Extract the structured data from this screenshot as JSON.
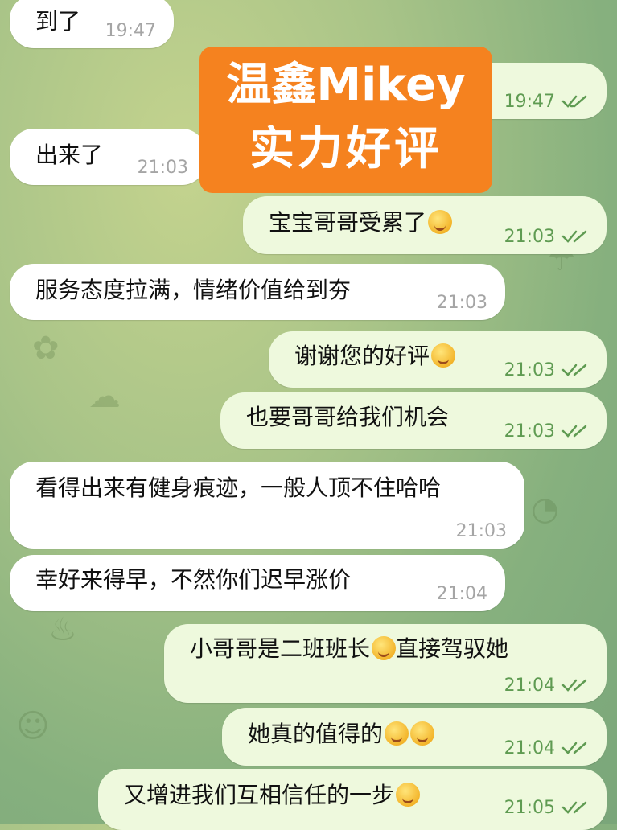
{
  "overlay": {
    "line1": "温鑫Mikey",
    "line2": "实力好评"
  },
  "messages": [
    {
      "id": "m1",
      "dir": "in",
      "text": "到了",
      "time": "19:47"
    },
    {
      "id": "m2",
      "dir": "out",
      "text": "",
      "time": "19:47"
    },
    {
      "id": "m3",
      "dir": "in",
      "text": "出来了",
      "time": "21:03"
    },
    {
      "id": "m4",
      "dir": "out",
      "text": "宝宝哥哥受累了",
      "emoji": [
        "face-blowing-kiss"
      ],
      "time": "21:03"
    },
    {
      "id": "m5",
      "dir": "in",
      "text": "服务态度拉满，情绪价值给到夯",
      "time": "21:03"
    },
    {
      "id": "m6",
      "dir": "out",
      "text": "谢谢您的好评",
      "emoji": [
        "face-savoring-food"
      ],
      "time": "21:03"
    },
    {
      "id": "m7",
      "dir": "out",
      "text": "也要哥哥给我们机会",
      "time": "21:03"
    },
    {
      "id": "m8",
      "dir": "in",
      "text": "看得出来有健身痕迹，一般人顶不住哈哈",
      "time": "21:03"
    },
    {
      "id": "m9",
      "dir": "in",
      "text": "幸好来得早，不然你们迟早涨价",
      "time": "21:04"
    },
    {
      "id": "m10",
      "dir": "out",
      "text": "小哥哥是二班班长",
      "text2": "直接驾驭她",
      "emoji": [
        "face-with-crown"
      ],
      "time": "21:04"
    },
    {
      "id": "m11",
      "dir": "out",
      "text": "她真的值得的",
      "emoji": [
        "partying-face",
        "partying-face"
      ],
      "time": "21:04"
    },
    {
      "id": "m12",
      "dir": "out",
      "text": "又增进我们互相信任的一步",
      "emoji": [
        "face-blowing-kiss"
      ],
      "time": "21:05"
    }
  ],
  "colors": {
    "incoming_bubble": "#ffffff",
    "outgoing_bubble": "#eef9dd",
    "read_check": "#5f9b52",
    "banner": "#f5821f"
  }
}
